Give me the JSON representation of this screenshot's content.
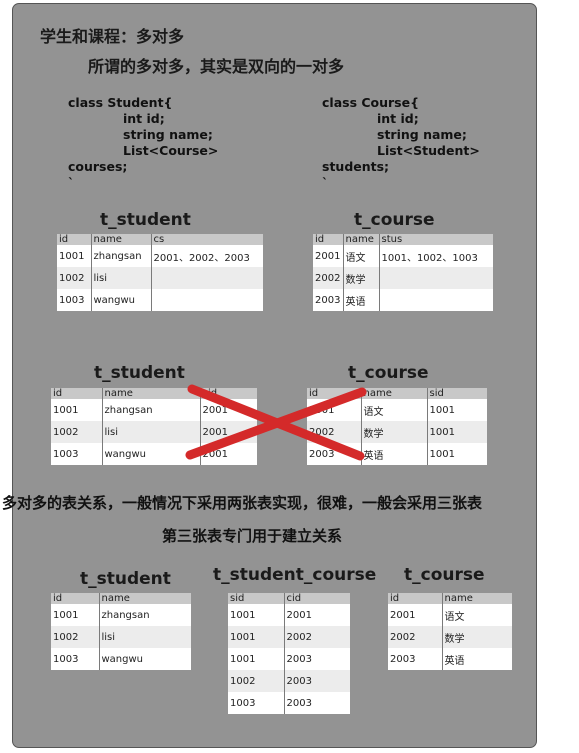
{
  "heading": "学生和课程：多对多",
  "subheading": "所谓的多对多，其实是双向的一对多",
  "code_student": [
    "class Student{",
    "int id;",
    "string name;",
    "List<Course>",
    "courses;",
    "`"
  ],
  "code_course": [
    "class Course{",
    "int id;",
    "string name;",
    "List<Student>",
    "students;",
    "`"
  ],
  "section1": {
    "student": {
      "name": "t_student",
      "headers": [
        "id",
        "name",
        "cs"
      ],
      "rows": [
        [
          "1001",
          "zhangsan",
          "2001、2002、2003"
        ],
        [
          "1002",
          "lisi",
          ""
        ],
        [
          "1003",
          "wangwu",
          ""
        ]
      ]
    },
    "course": {
      "name": "t_course",
      "headers": [
        "id",
        "name",
        "stus"
      ],
      "rows": [
        [
          "2001",
          "语文",
          "1001、1002、1003"
        ],
        [
          "2002",
          "数学",
          ""
        ],
        [
          "2003",
          "英语",
          ""
        ]
      ]
    }
  },
  "section2": {
    "student": {
      "name": "t_student",
      "headers": [
        "id",
        "name",
        "cid"
      ],
      "rows": [
        [
          "1001",
          "zhangsan",
          "2001"
        ],
        [
          "1002",
          "lisi",
          "2001"
        ],
        [
          "1003",
          "wangwu",
          "2001"
        ]
      ]
    },
    "course": {
      "name": "t_course",
      "headers": [
        "id",
        "name",
        "sid"
      ],
      "rows": [
        [
          "2001",
          "语文",
          "1001"
        ],
        [
          "2002",
          "数学",
          "1001"
        ],
        [
          "2003",
          "英语",
          "1001"
        ]
      ]
    },
    "cross_color": "#d42a2a"
  },
  "note1": "多对多的表关系，一般情况下采用两张表实现，很难，一般会采用三张表",
  "note2": "第三张表专门用于建立关系",
  "section3": {
    "student": {
      "name": "t_student",
      "headers": [
        "id",
        "name"
      ],
      "rows": [
        [
          "1001",
          "zhangsan"
        ],
        [
          "1002",
          "lisi"
        ],
        [
          "1003",
          "wangwu"
        ]
      ]
    },
    "link": {
      "name": "t_student_course",
      "headers": [
        "sid",
        "cid"
      ],
      "rows": [
        [
          "1001",
          "2001"
        ],
        [
          "1001",
          "2002"
        ],
        [
          "1001",
          "2003"
        ],
        [
          "1002",
          "2003"
        ],
        [
          "1003",
          "2003"
        ]
      ]
    },
    "course": {
      "name": "t_course",
      "headers": [
        "id",
        "name"
      ],
      "rows": [
        [
          "2001",
          "语文"
        ],
        [
          "2002",
          "数学"
        ],
        [
          "2003",
          "英语"
        ]
      ]
    }
  }
}
